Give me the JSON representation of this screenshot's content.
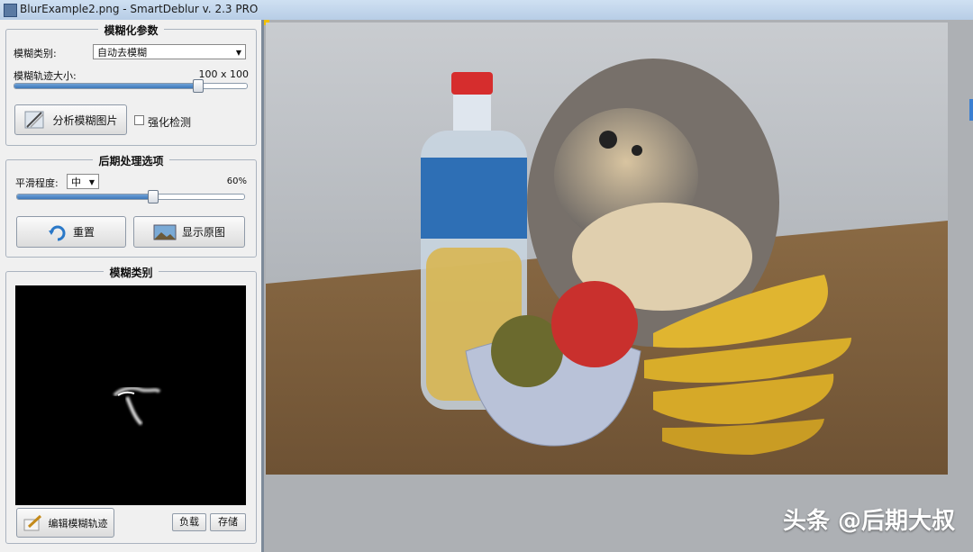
{
  "window": {
    "title": "BlurExample2.png - SmartDeblur v. 2.3 PRO",
    "icon": "app-window-icon"
  },
  "blur_params": {
    "group_title": "模糊化参数",
    "blur_type_label": "模糊类别:",
    "blur_type_value": "自动去模糊",
    "trajectory_label": "模糊轨迹大小:",
    "trajectory_value": "100 x 100",
    "trajectory_level": 0.79,
    "analyze_button": "分析模糊图片",
    "enhance_checkbox": "强化检测",
    "enhance_checked": false
  },
  "post_processing": {
    "group_title": "后期处理选项",
    "smooth_label": "平滑程度:",
    "smooth_value": "中",
    "smooth_percent": "60%",
    "smooth_level": 0.6,
    "reset_button": "重置",
    "show_original_button": "显示原图"
  },
  "blur_kernel": {
    "group_title": "模糊类别",
    "edit_button": "编辑模糊轨迹",
    "load_button": "负载",
    "save_button": "存储"
  },
  "watermark": "头条 @后期大叔",
  "colors": {
    "accent": "#3c77b8",
    "panel_bg": "#f0f0f0",
    "canvas_bg": "#adb0b4"
  }
}
